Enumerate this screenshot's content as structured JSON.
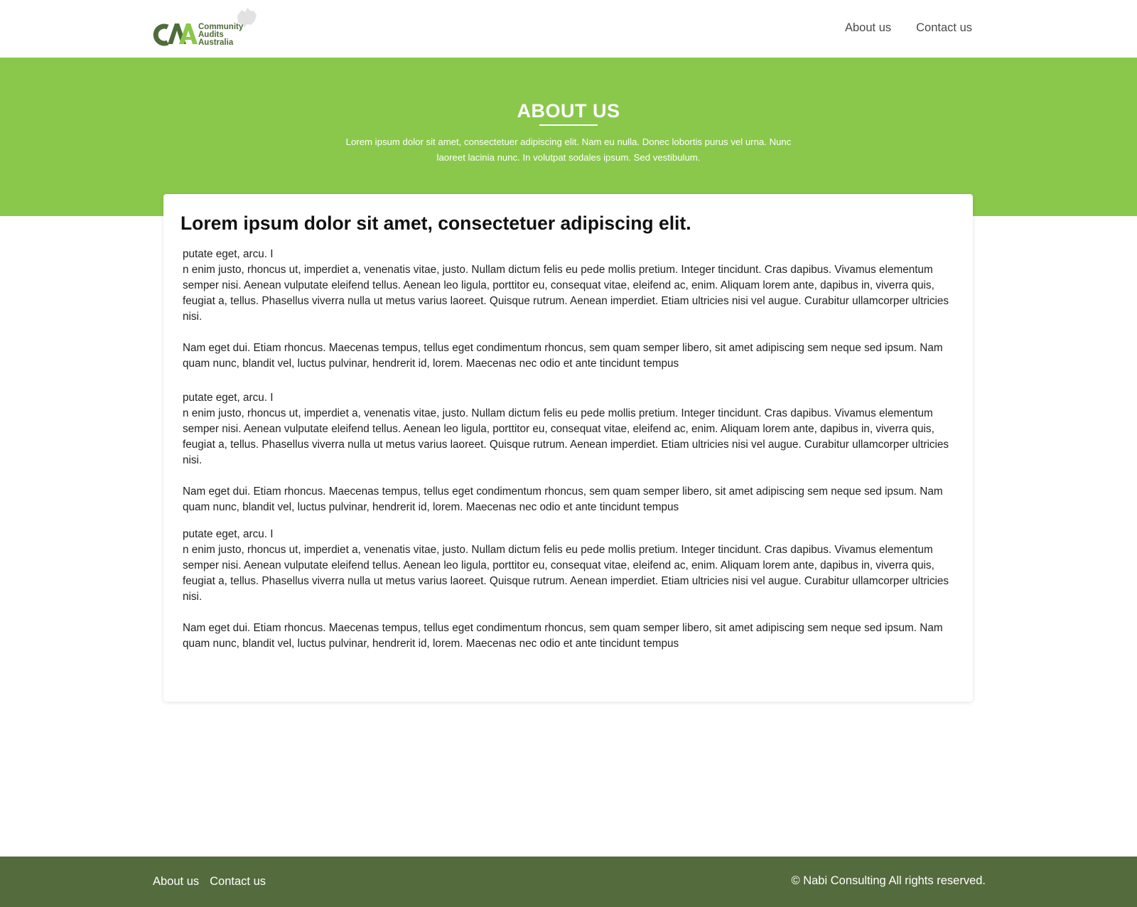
{
  "header": {
    "logo_text": [
      "Community",
      "Audits",
      "Australia"
    ],
    "nav": [
      {
        "label": "About us"
      },
      {
        "label": "Contact us"
      }
    ]
  },
  "hero": {
    "title": "ABOUT US",
    "subtitle": "Lorem ipsum dolor sit amet, consectetuer adipiscing elit. Nam eu nulla. Donec lobortis purus vel urna. Nunc laoreet lacinia nunc. In volutpat sodales ipsum. Sed vestibulum."
  },
  "content": {
    "heading": "Lorem ipsum dolor sit amet, consectetuer adipiscing elit.",
    "sections": [
      {
        "line1": "putate eget, arcu. I",
        "para1": "n enim justo, rhoncus ut, imperdiet a, venenatis vitae, justo. Nullam dictum felis eu pede mollis pretium. Integer tincidunt. Cras dapibus. Vivamus elementum semper nisi. Aenean vulputate eleifend tellus. Aenean leo ligula, porttitor eu, consequat vitae, eleifend ac, enim. Aliquam lorem ante, dapibus in, viverra quis, feugiat a, tellus. Phasellus viverra nulla ut metus varius laoreet. Quisque rutrum. Aenean imperdiet. Etiam ultricies nisi vel augue. Curabitur ullamcorper ultricies nisi.",
        "para2": " Nam eget dui. Etiam rhoncus. Maecenas tempus, tellus eget condimentum rhoncus, sem quam semper libero, sit amet adipiscing sem neque sed ipsum. Nam quam nunc, blandit vel, luctus pulvinar, hendrerit id, lorem. Maecenas nec odio et ante tincidunt tempus"
      },
      {
        "line1": "putate eget, arcu. I",
        "para1": "n enim justo, rhoncus ut, imperdiet a, venenatis vitae, justo. Nullam dictum felis eu pede mollis pretium. Integer tincidunt. Cras dapibus. Vivamus elementum semper nisi. Aenean vulputate eleifend tellus. Aenean leo ligula, porttitor eu, consequat vitae, eleifend ac, enim. Aliquam lorem ante, dapibus in, viverra quis, feugiat a, tellus. Phasellus viverra nulla ut metus varius laoreet. Quisque rutrum. Aenean imperdiet. Etiam ultricies nisi vel augue. Curabitur ullamcorper ultricies nisi.",
        "para2": " Nam eget dui. Etiam rhoncus. Maecenas tempus, tellus eget condimentum rhoncus, sem quam semper libero, sit amet adipiscing sem neque sed ipsum. Nam quam nunc, blandit vel, luctus pulvinar, hendrerit id, lorem. Maecenas nec odio et ante tincidunt tempus"
      },
      {
        "line1": "putate eget, arcu. I",
        "para1": "n enim justo, rhoncus ut, imperdiet a, venenatis vitae, justo. Nullam dictum felis eu pede mollis pretium. Integer tincidunt. Cras dapibus. Vivamus elementum semper nisi. Aenean vulputate eleifend tellus. Aenean leo ligula, porttitor eu, consequat vitae, eleifend ac, enim. Aliquam lorem ante, dapibus in, viverra quis, feugiat a, tellus. Phasellus viverra nulla ut metus varius laoreet. Quisque rutrum. Aenean imperdiet. Etiam ultricies nisi vel augue. Curabitur ullamcorper ultricies nisi.",
        "para2": " Nam eget dui. Etiam rhoncus. Maecenas tempus, tellus eget condimentum rhoncus, sem quam semper libero, sit amet adipiscing sem neque sed ipsum. Nam quam nunc, blandit vel, luctus pulvinar, hendrerit id, lorem. Maecenas nec odio et ante tincidunt tempus"
      }
    ]
  },
  "footer": {
    "links": [
      {
        "label": "About us"
      },
      {
        "label": "Contact us"
      }
    ],
    "copyright": "© Nabi Consulting All rights reserved."
  },
  "colors": {
    "brand_green": "#8ac84b",
    "footer_green": "#546b3d",
    "logo_dark": "#4f6b3a"
  }
}
